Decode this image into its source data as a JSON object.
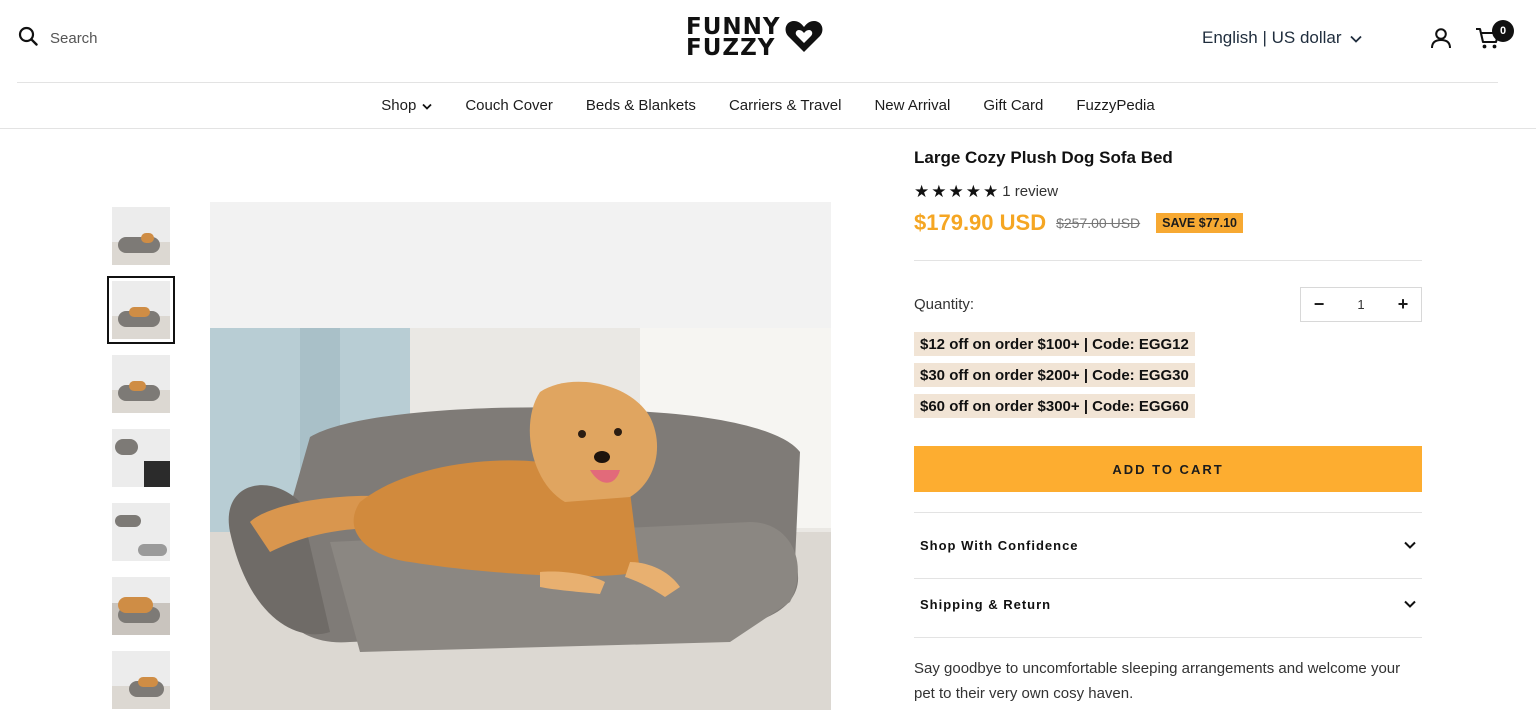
{
  "header": {
    "search_label": "Search",
    "logo_line1": "FUNNY",
    "logo_line2": "FUZZY",
    "locale": "English | US dollar",
    "cart_count": "0"
  },
  "nav": {
    "items": [
      "Shop",
      "Couch Cover",
      "Beds & Blankets",
      "Carriers & Travel",
      "New Arrival",
      "Gift Card",
      "FuzzyPedia"
    ]
  },
  "product": {
    "title": "Large Cozy Plush Dog Sofa Bed",
    "rating": 5,
    "reviews": "1 review",
    "price": "$179.90 USD",
    "old_price": "$257.00 USD",
    "save": "SAVE $77.10",
    "quantity_label": "Quantity:",
    "quantity": "1",
    "promos": [
      "$12 off on order $100+ | Code: EGG12",
      "$30 off on order $200+ | Code: EGG30",
      "$60 off on order $300+ | Code: EGG60"
    ],
    "add_to_cart": "ADD TO CART",
    "accordions": [
      "Shop With Confidence",
      "Shipping & Return"
    ],
    "description": "Say goodbye to uncomfortable sleeping arrangements and welcome your pet to their very own cosy haven."
  },
  "colors": {
    "accent": "#fdad30",
    "price": "#f5a623",
    "promo_bg": "#f1e4d5"
  },
  "icons": {
    "search": "search-icon",
    "heart_logo": "heart-logo-icon",
    "chevron": "chevron-down-icon",
    "account": "user-icon",
    "cart": "cart-icon",
    "star": "star-icon"
  }
}
